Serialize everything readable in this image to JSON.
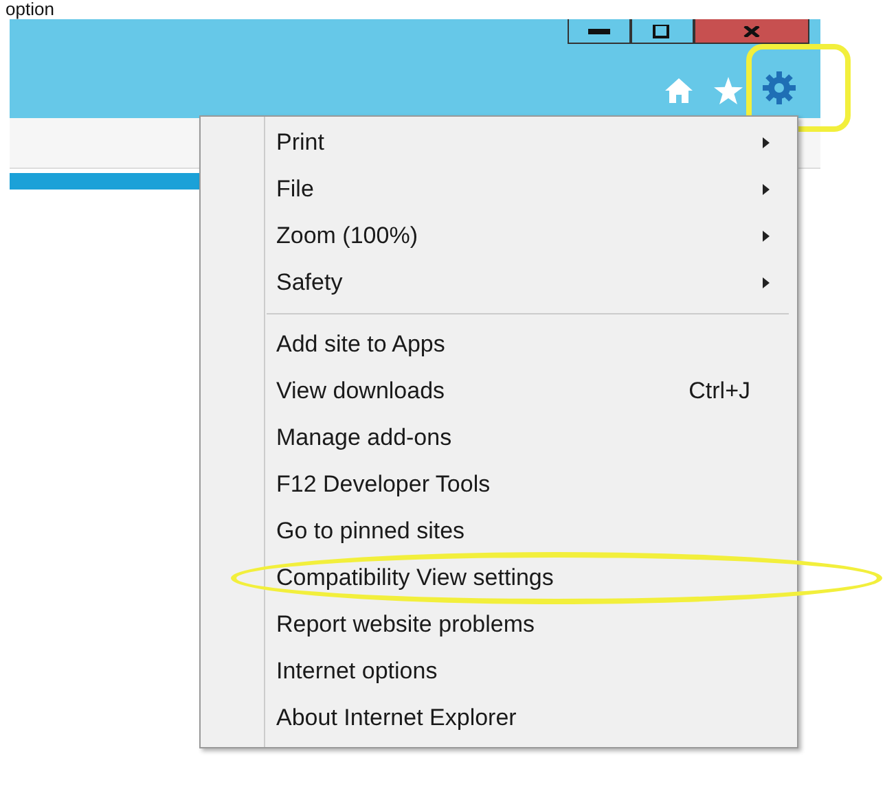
{
  "caption": "option",
  "toolbar": {
    "gear_circled": true
  },
  "menu": {
    "items": [
      {
        "kind": "submenu",
        "label": "Print",
        "circled": false
      },
      {
        "kind": "submenu",
        "label": "File",
        "circled": false
      },
      {
        "kind": "submenu",
        "label": "Zoom (100%)",
        "circled": false
      },
      {
        "kind": "submenu",
        "label": "Safety",
        "circled": false
      },
      {
        "kind": "separator"
      },
      {
        "kind": "item",
        "label": "Add site to Apps",
        "circled": false
      },
      {
        "kind": "item",
        "label": "View downloads",
        "shortcut": "Ctrl+J",
        "circled": false
      },
      {
        "kind": "item",
        "label": "Manage add-ons",
        "circled": false
      },
      {
        "kind": "item",
        "label": "F12 Developer Tools",
        "circled": false
      },
      {
        "kind": "item",
        "label": "Go to pinned sites",
        "circled": false
      },
      {
        "kind": "item",
        "label": "Compatibility View settings",
        "circled": true
      },
      {
        "kind": "item",
        "label": "Report website problems",
        "circled": false
      },
      {
        "kind": "item",
        "label": "Internet options",
        "circled": false
      },
      {
        "kind": "item",
        "label": "About Internet Explorer",
        "circled": false
      }
    ]
  }
}
